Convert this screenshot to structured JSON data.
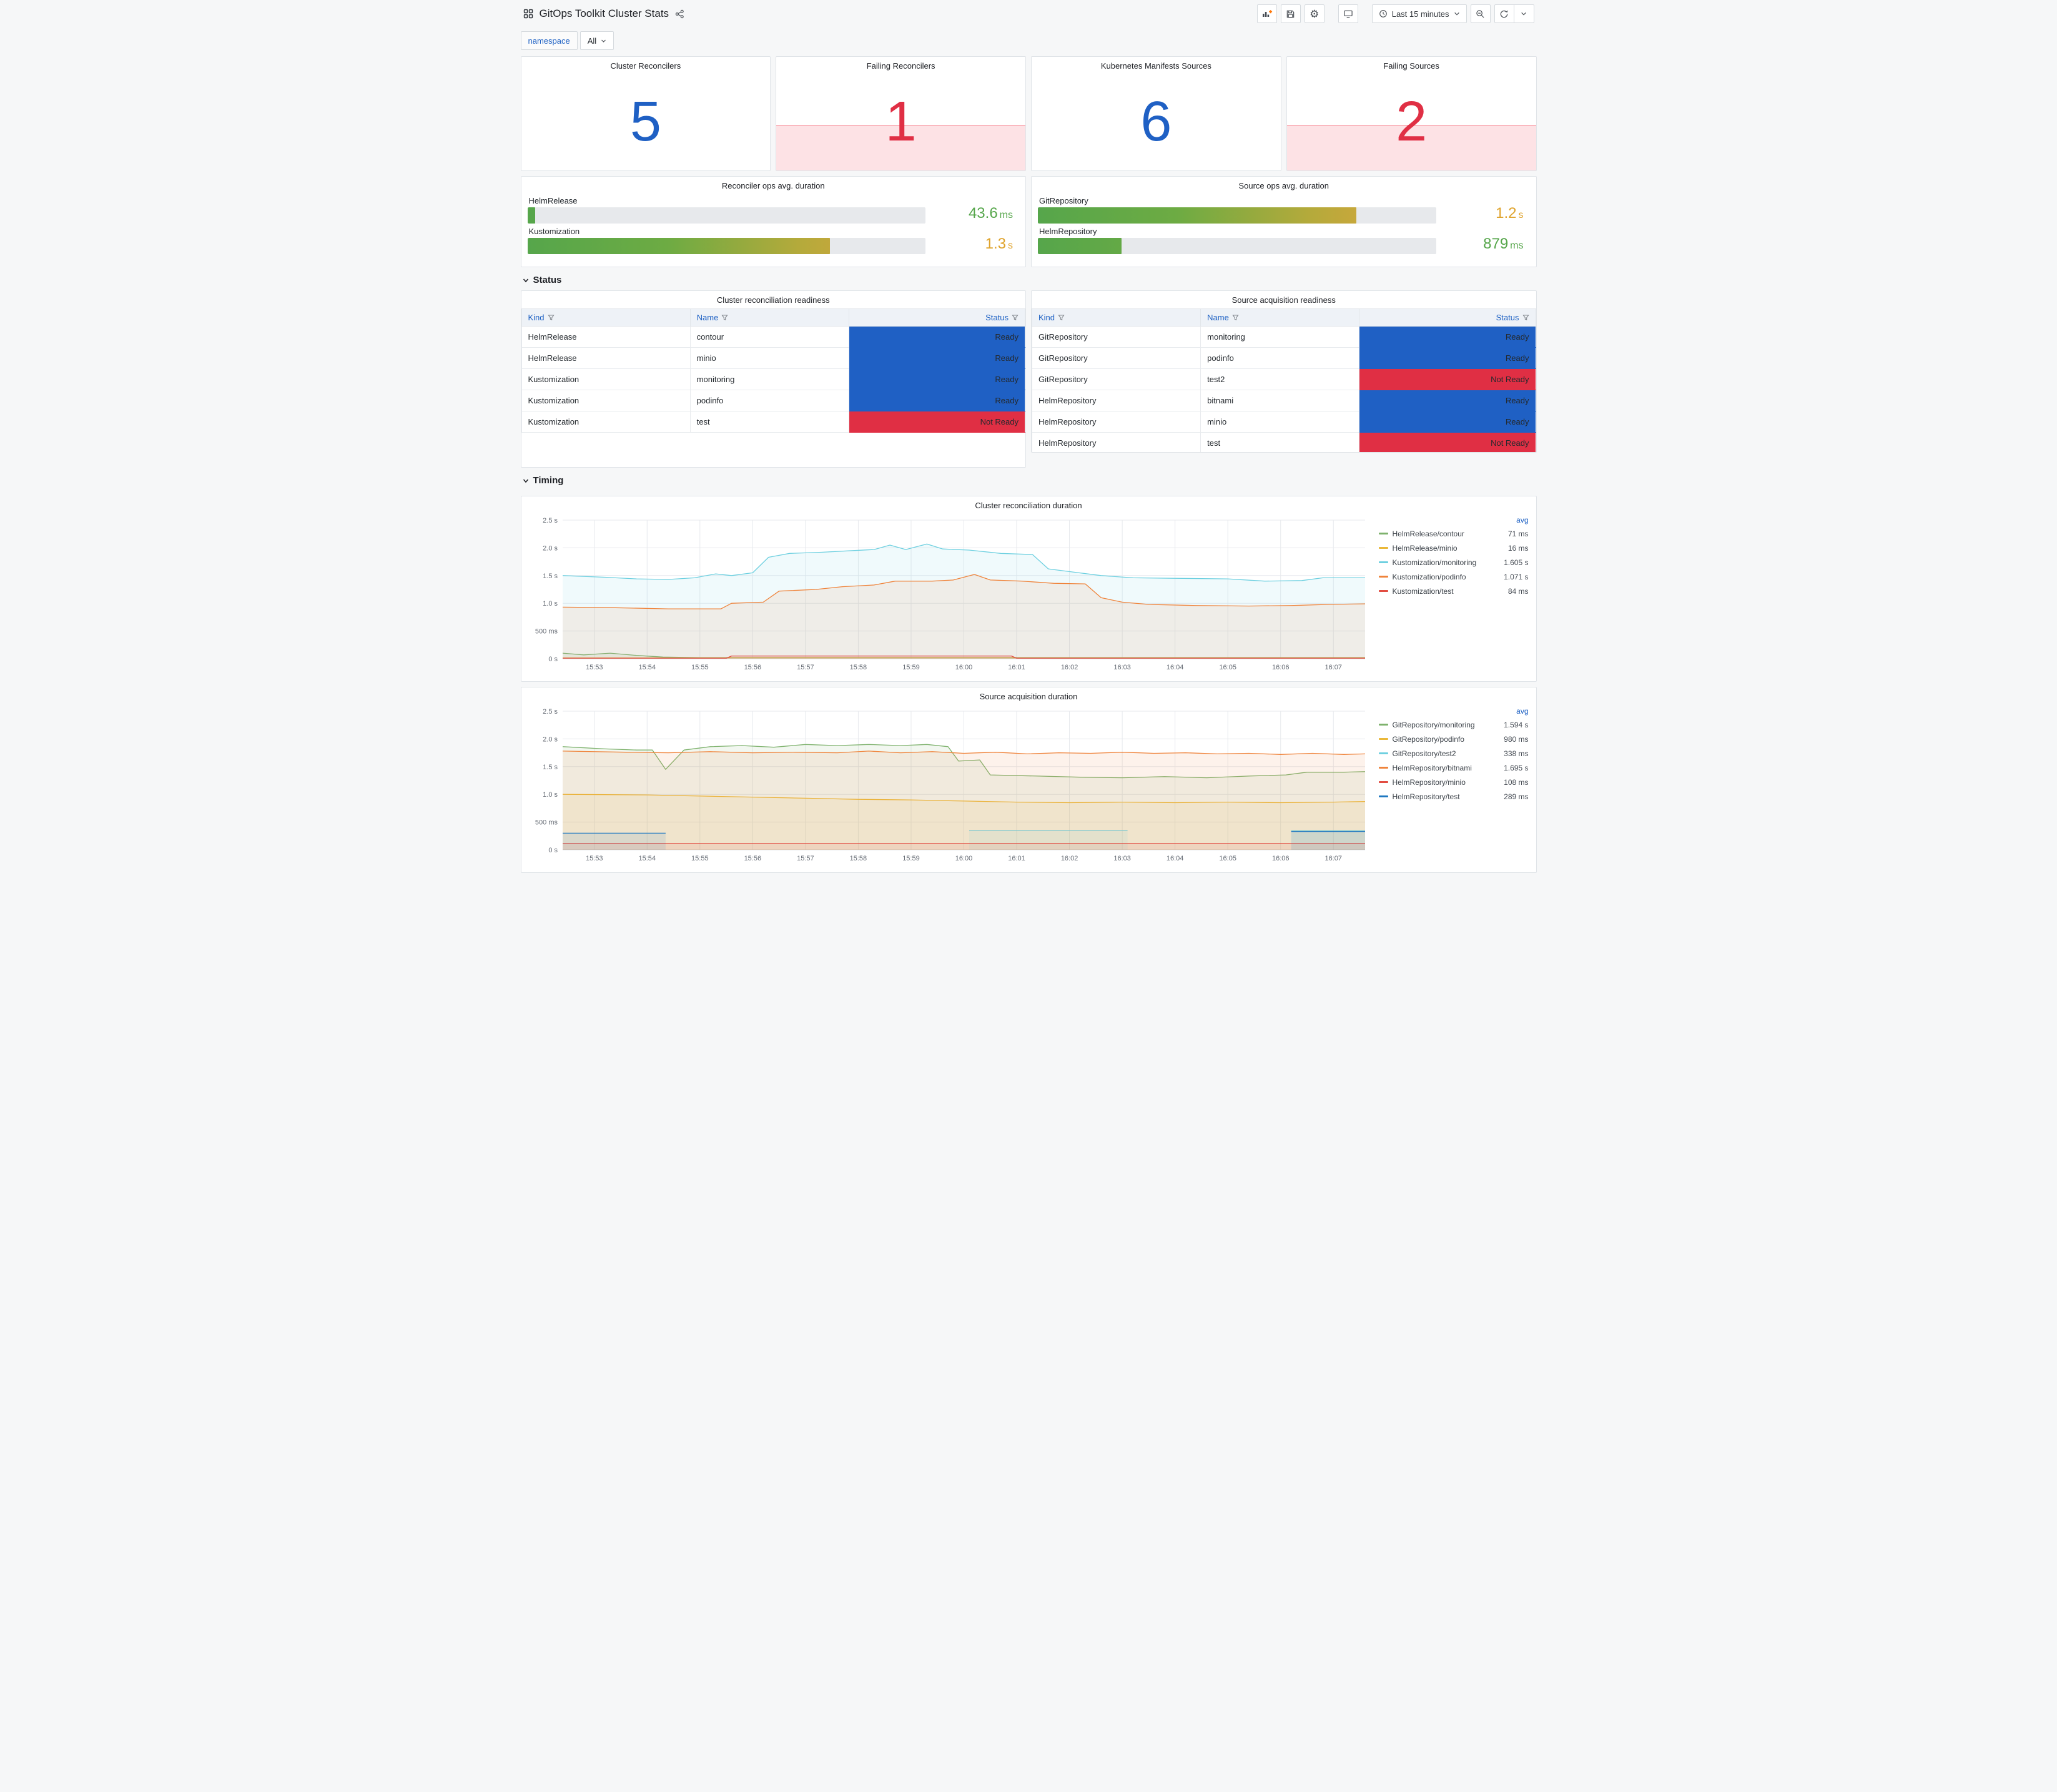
{
  "header": {
    "title": "GitOps Toolkit Cluster Stats",
    "time_picker": "Last 15 minutes"
  },
  "variables": [
    {
      "label": "namespace",
      "value": "All"
    }
  ],
  "stat_panels": [
    {
      "title": "Cluster Reconcilers",
      "value": "5",
      "state": "ok"
    },
    {
      "title": "Failing Reconcilers",
      "value": "1",
      "state": "alert"
    },
    {
      "title": "Kubernetes Manifests Sources",
      "value": "6",
      "state": "ok"
    },
    {
      "title": "Failing Sources",
      "value": "2",
      "state": "alert"
    }
  ],
  "gauge_panels": [
    {
      "title": "Reconciler ops avg. duration",
      "bars": [
        {
          "label": "HelmRelease",
          "value": "43.6",
          "unit": "ms",
          "percent": 2,
          "value_color": "#56a64b"
        },
        {
          "label": "Kustomization",
          "value": "1.3",
          "unit": "s",
          "percent": 76,
          "value_color": "#dfa32c"
        }
      ]
    },
    {
      "title": "Source ops avg. duration",
      "bars": [
        {
          "label": "GitRepository",
          "value": "1.2",
          "unit": "s",
          "percent": 80,
          "value_color": "#dfa32c"
        },
        {
          "label": "HelmRepository",
          "value": "879",
          "unit": "ms",
          "percent": 21,
          "value_color": "#56a64b"
        }
      ]
    }
  ],
  "sections": [
    {
      "label": "Status"
    },
    {
      "label": "Timing"
    }
  ],
  "table_panels": [
    {
      "title": "Cluster reconciliation readiness",
      "columns": [
        "Kind",
        "Name",
        "Status"
      ],
      "rows": [
        [
          "HelmRelease",
          "contour",
          "Ready"
        ],
        [
          "HelmRelease",
          "minio",
          "Ready"
        ],
        [
          "Kustomization",
          "monitoring",
          "Ready"
        ],
        [
          "Kustomization",
          "podinfo",
          "Ready"
        ],
        [
          "Kustomization",
          "test",
          "Not Ready"
        ]
      ]
    },
    {
      "title": "Source acquisition readiness",
      "columns": [
        "Kind",
        "Name",
        "Status"
      ],
      "rows": [
        [
          "GitRepository",
          "monitoring",
          "Ready"
        ],
        [
          "GitRepository",
          "podinfo",
          "Ready"
        ],
        [
          "GitRepository",
          "test2",
          "Not Ready"
        ],
        [
          "HelmRepository",
          "bitnami",
          "Ready"
        ],
        [
          "HelmRepository",
          "minio",
          "Ready"
        ],
        [
          "HelmRepository",
          "test",
          "Not Ready"
        ]
      ]
    }
  ],
  "chart_data": [
    {
      "type": "line",
      "title": "Cluster reconciliation duration",
      "legend_header": "avg",
      "xlim": [
        -0.6,
        14.6
      ],
      "ylim": [
        0,
        2.5
      ],
      "x_ticks": [
        [
          0,
          "15:53"
        ],
        [
          1,
          "15:54"
        ],
        [
          2,
          "15:55"
        ],
        [
          3,
          "15:56"
        ],
        [
          4,
          "15:57"
        ],
        [
          5,
          "15:58"
        ],
        [
          6,
          "15:59"
        ],
        [
          7,
          "16:00"
        ],
        [
          8,
          "16:01"
        ],
        [
          9,
          "16:02"
        ],
        [
          10,
          "16:03"
        ],
        [
          11,
          "16:04"
        ],
        [
          12,
          "16:05"
        ],
        [
          13,
          "16:06"
        ],
        [
          14,
          "16:07"
        ]
      ],
      "y_ticks": [
        [
          0,
          "0 s"
        ],
        [
          0.5,
          "500 ms"
        ],
        [
          1,
          "1.0 s"
        ],
        [
          1.5,
          "1.5 s"
        ],
        [
          2,
          "2.0 s"
        ],
        [
          2.5,
          "2.5 s"
        ]
      ],
      "series": [
        {
          "name": "HelmRelease/contour",
          "avg": "71 ms",
          "color": "#7EB26D",
          "points": [
            [
              -0.6,
              0.1
            ],
            [
              -0.2,
              0.07
            ],
            [
              0.3,
              0.1
            ],
            [
              0.8,
              0.06
            ],
            [
              1.3,
              0.03
            ],
            [
              2,
              0.02
            ],
            [
              14.6,
              0.02
            ]
          ]
        },
        {
          "name": "HelmRelease/minio",
          "avg": "16 ms",
          "color": "#EAB839",
          "points": [
            [
              -0.6,
              0.016
            ],
            [
              14.6,
              0.016
            ]
          ]
        },
        {
          "name": "Kustomization/monitoring",
          "avg": "1.605 s",
          "color": "#6ED0E0",
          "points": [
            [
              -0.6,
              1.5
            ],
            [
              0.2,
              1.47
            ],
            [
              0.8,
              1.44
            ],
            [
              1.4,
              1.43
            ],
            [
              1.9,
              1.46
            ],
            [
              2.3,
              1.53
            ],
            [
              2.6,
              1.5
            ],
            [
              3,
              1.55
            ],
            [
              3.3,
              1.83
            ],
            [
              3.7,
              1.9
            ],
            [
              4.3,
              1.92
            ],
            [
              4.9,
              1.95
            ],
            [
              5.3,
              1.97
            ],
            [
              5.6,
              2.05
            ],
            [
              5.9,
              1.97
            ],
            [
              6.3,
              2.07
            ],
            [
              6.6,
              1.98
            ],
            [
              7.1,
              1.96
            ],
            [
              7.7,
              1.9
            ],
            [
              8.3,
              1.88
            ],
            [
              8.6,
              1.62
            ],
            [
              9.1,
              1.56
            ],
            [
              9.6,
              1.5
            ],
            [
              10.2,
              1.46
            ],
            [
              11,
              1.45
            ],
            [
              12,
              1.44
            ],
            [
              12.7,
              1.4
            ],
            [
              13.4,
              1.41
            ],
            [
              13.8,
              1.46
            ],
            [
              14.6,
              1.46
            ]
          ]
        },
        {
          "name": "Kustomization/podinfo",
          "avg": "1.071 s",
          "color": "#EF843C",
          "points": [
            [
              -0.6,
              0.93
            ],
            [
              0.4,
              0.92
            ],
            [
              1.4,
              0.9
            ],
            [
              2.4,
              0.9
            ],
            [
              2.6,
              1.0
            ],
            [
              3.2,
              1.02
            ],
            [
              3.5,
              1.22
            ],
            [
              4.2,
              1.25
            ],
            [
              4.7,
              1.3
            ],
            [
              5.3,
              1.33
            ],
            [
              5.7,
              1.4
            ],
            [
              6.4,
              1.4
            ],
            [
              6.8,
              1.42
            ],
            [
              7.2,
              1.52
            ],
            [
              7.5,
              1.42
            ],
            [
              8.1,
              1.4
            ],
            [
              8.7,
              1.36
            ],
            [
              9.3,
              1.35
            ],
            [
              9.6,
              1.1
            ],
            [
              10,
              1.02
            ],
            [
              10.5,
              0.98
            ],
            [
              11.4,
              0.96
            ],
            [
              12.4,
              0.95
            ],
            [
              13.2,
              0.96
            ],
            [
              13.9,
              0.98
            ],
            [
              14.6,
              0.99
            ]
          ]
        },
        {
          "name": "Kustomization/test",
          "avg": "84 ms",
          "color": "#E24D42",
          "points": [
            [
              -0.6,
              0.01
            ],
            [
              2.5,
              0.01
            ],
            [
              2.6,
              0.05
            ],
            [
              7.9,
              0.05
            ],
            [
              8,
              0.01
            ],
            [
              14.6,
              0.01
            ]
          ]
        }
      ]
    },
    {
      "type": "line",
      "title": "Source acquisition duration",
      "legend_header": "avg",
      "xlim": [
        -0.6,
        14.6
      ],
      "ylim": [
        0,
        2.5
      ],
      "x_ticks": [
        [
          0,
          "15:53"
        ],
        [
          1,
          "15:54"
        ],
        [
          2,
          "15:55"
        ],
        [
          3,
          "15:56"
        ],
        [
          4,
          "15:57"
        ],
        [
          5,
          "15:58"
        ],
        [
          6,
          "15:59"
        ],
        [
          7,
          "16:00"
        ],
        [
          8,
          "16:01"
        ],
        [
          9,
          "16:02"
        ],
        [
          10,
          "16:03"
        ],
        [
          11,
          "16:04"
        ],
        [
          12,
          "16:05"
        ],
        [
          13,
          "16:06"
        ],
        [
          14,
          "16:07"
        ]
      ],
      "y_ticks": [
        [
          0,
          "0 s"
        ],
        [
          0.5,
          "500 ms"
        ],
        [
          1,
          "1.0 s"
        ],
        [
          1.5,
          "1.5 s"
        ],
        [
          2,
          "2.0 s"
        ],
        [
          2.5,
          "2.5 s"
        ]
      ],
      "series": [
        {
          "name": "GitRepository/monitoring",
          "avg": "1.594 s",
          "color": "#7EB26D",
          "points": [
            [
              -0.6,
              1.86
            ],
            [
              0.2,
              1.82
            ],
            [
              0.8,
              1.8
            ],
            [
              1.1,
              1.8
            ],
            [
              1.35,
              1.45
            ],
            [
              1.7,
              1.8
            ],
            [
              2.2,
              1.86
            ],
            [
              2.8,
              1.88
            ],
            [
              3.4,
              1.85
            ],
            [
              4,
              1.9
            ],
            [
              4.6,
              1.88
            ],
            [
              5.2,
              1.9
            ],
            [
              5.8,
              1.88
            ],
            [
              6.3,
              1.9
            ],
            [
              6.7,
              1.86
            ],
            [
              6.9,
              1.6
            ],
            [
              7.3,
              1.62
            ],
            [
              7.5,
              1.35
            ],
            [
              8.4,
              1.33
            ],
            [
              9.2,
              1.31
            ],
            [
              10,
              1.3
            ],
            [
              10.8,
              1.32
            ],
            [
              11.6,
              1.3
            ],
            [
              12.4,
              1.33
            ],
            [
              13.1,
              1.35
            ],
            [
              13.5,
              1.4
            ],
            [
              14.2,
              1.4
            ],
            [
              14.6,
              1.41
            ]
          ]
        },
        {
          "name": "GitRepository/podinfo",
          "avg": "980 ms",
          "color": "#EAB839",
          "points": [
            [
              -0.6,
              1.0
            ],
            [
              1,
              0.99
            ],
            [
              2,
              0.97
            ],
            [
              3,
              0.95
            ],
            [
              4,
              0.93
            ],
            [
              5,
              0.91
            ],
            [
              6,
              0.9
            ],
            [
              7,
              0.88
            ],
            [
              8,
              0.86
            ],
            [
              9,
              0.85
            ],
            [
              10,
              0.86
            ],
            [
              11,
              0.85
            ],
            [
              12,
              0.86
            ],
            [
              13,
              0.85
            ],
            [
              14,
              0.86
            ],
            [
              14.6,
              0.87
            ]
          ]
        },
        {
          "name": "GitRepository/test2",
          "avg": "338 ms",
          "color": "#6ED0E0",
          "points": [
            [
              7.1,
              0.35
            ],
            [
              10.1,
              0.35
            ],
            null,
            [
              13.2,
              0.35
            ],
            [
              14.6,
              0.35
            ]
          ]
        },
        {
          "name": "HelmRepository/bitnami",
          "avg": "1.695 s",
          "color": "#EF843C",
          "points": [
            [
              -0.6,
              1.78
            ],
            [
              0.6,
              1.76
            ],
            [
              1.4,
              1.75
            ],
            [
              2.2,
              1.77
            ],
            [
              3,
              1.75
            ],
            [
              3.8,
              1.76
            ],
            [
              4.6,
              1.75
            ],
            [
              5.2,
              1.78
            ],
            [
              5.8,
              1.75
            ],
            [
              6.4,
              1.77
            ],
            [
              7,
              1.74
            ],
            [
              7.6,
              1.76
            ],
            [
              8.2,
              1.73
            ],
            [
              8.8,
              1.75
            ],
            [
              9.4,
              1.74
            ],
            [
              10,
              1.76
            ],
            [
              10.6,
              1.74
            ],
            [
              11.2,
              1.75
            ],
            [
              11.8,
              1.73
            ],
            [
              12.4,
              1.74
            ],
            [
              13,
              1.72
            ],
            [
              13.6,
              1.74
            ],
            [
              14.2,
              1.72
            ],
            [
              14.6,
              1.73
            ]
          ]
        },
        {
          "name": "HelmRepository/minio",
          "avg": "108 ms",
          "color": "#E24D42",
          "points": [
            [
              -0.6,
              0.11
            ],
            [
              14.6,
              0.11
            ]
          ]
        },
        {
          "name": "HelmRepository/test",
          "avg": "289 ms",
          "color": "#1F78C1",
          "points": [
            [
              -0.6,
              0.3
            ],
            [
              1.35,
              0.3
            ],
            null,
            [
              13.2,
              0.33
            ],
            [
              14.6,
              0.33
            ]
          ]
        }
      ]
    }
  ]
}
